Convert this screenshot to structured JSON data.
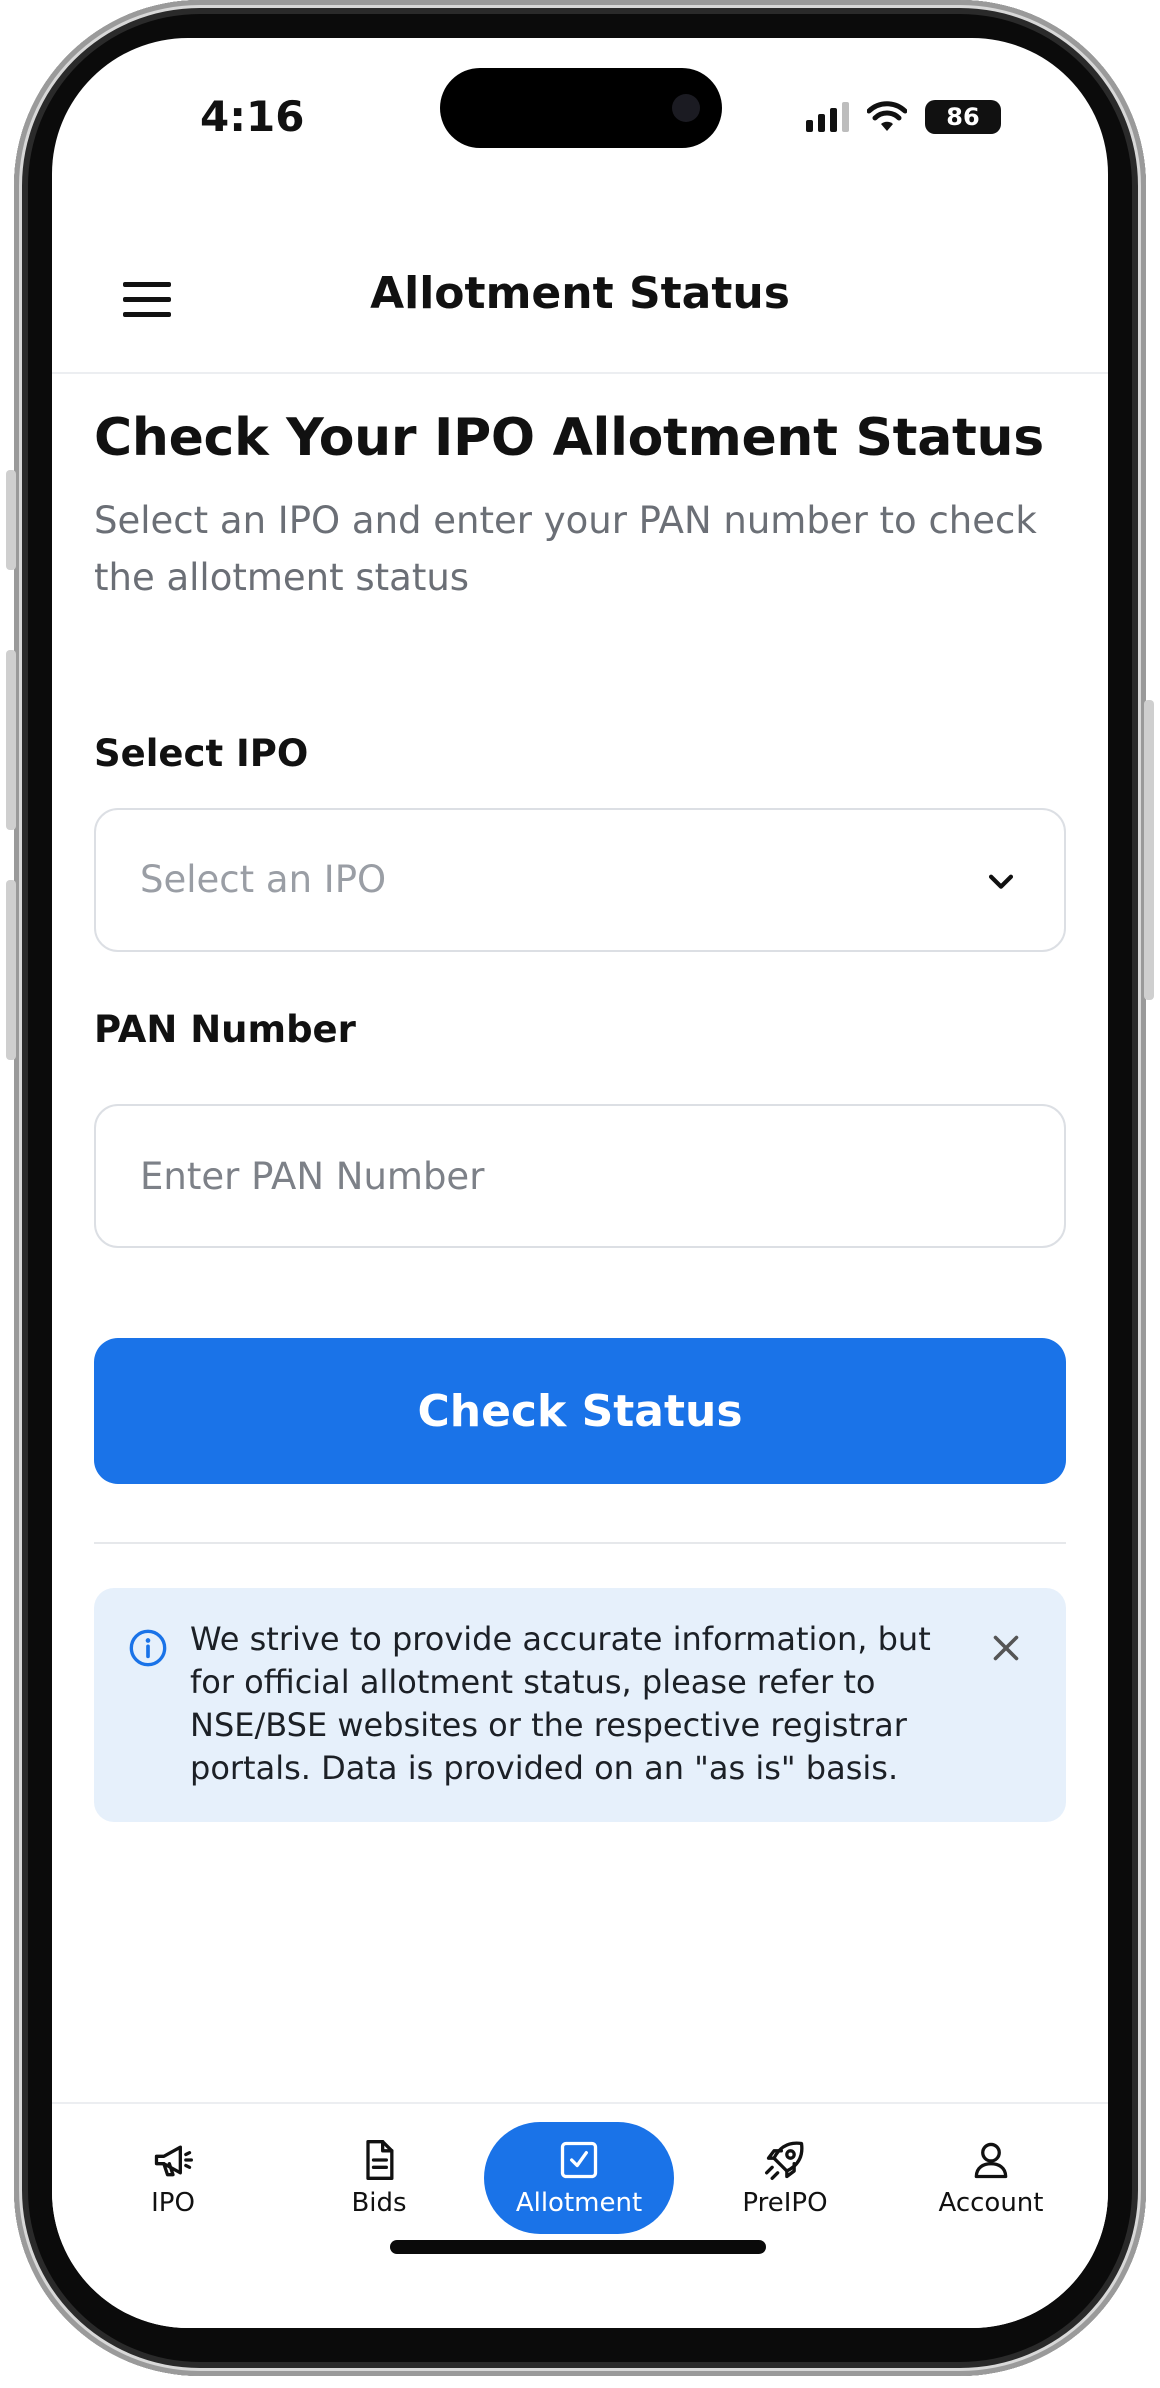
{
  "status_bar": {
    "time": "4:16",
    "battery": "86"
  },
  "header": {
    "title": "Allotment Status"
  },
  "main": {
    "heading": "Check Your IPO Allotment Status",
    "subheading": "Select an IPO and enter your PAN number to check the allotment status",
    "ipo_label": "Select IPO",
    "ipo_placeholder": "Select an IPO",
    "pan_label": "PAN Number",
    "pan_placeholder": "Enter PAN Number",
    "pan_value": "",
    "check_button": "Check Status"
  },
  "notice": {
    "text": "We strive to provide accurate information, but for official allotment status, please refer to NSE/BSE websites or the respective registrar portals. Data is provided on an \"as is\" basis."
  },
  "bottom_nav": {
    "items": [
      {
        "label": "IPO",
        "icon": "megaphone-icon",
        "active": false
      },
      {
        "label": "Bids",
        "icon": "document-icon",
        "active": false
      },
      {
        "label": "Allotment",
        "icon": "checkbox-icon",
        "active": true
      },
      {
        "label": "PreIPO",
        "icon": "rocket-icon",
        "active": false
      },
      {
        "label": "Account",
        "icon": "person-icon",
        "active": false
      }
    ]
  },
  "colors": {
    "primary": "#1a73e8",
    "notice_bg": "#e6f0fb",
    "text": "#111111",
    "muted": "#6b6f76"
  }
}
